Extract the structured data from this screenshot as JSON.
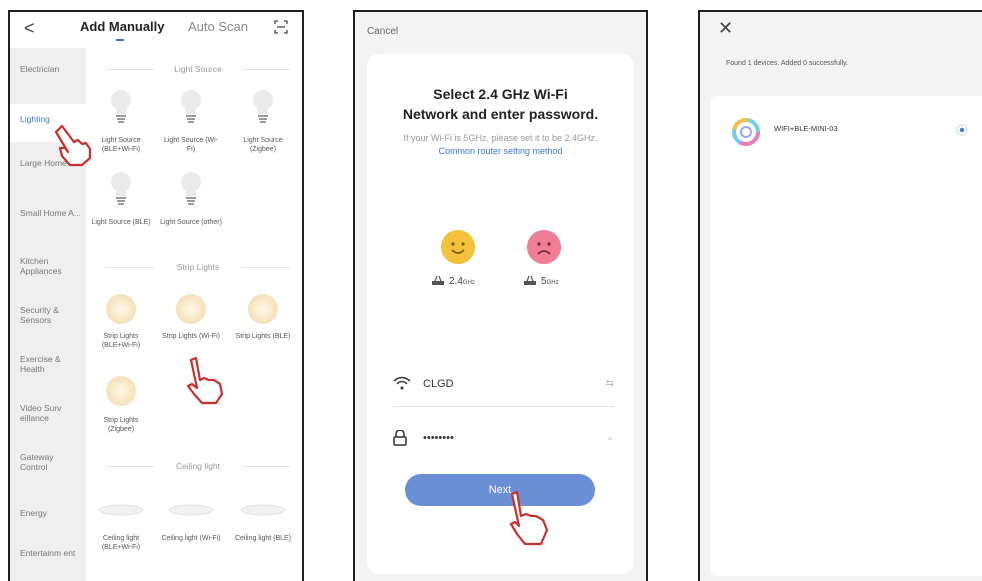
{
  "screen1": {
    "tabs": {
      "manual": "Add Manually",
      "auto": "Auto Scan"
    },
    "sidebar": [
      "Electrician",
      "Lighting",
      "Large Home A...",
      "Small Home A...",
      "Kitchen Appliances",
      "Security & Sensors",
      "Exercise & Health",
      "Video Surv eillance",
      "Gateway Control",
      "Energy",
      "Entertainm ent"
    ],
    "sections": {
      "light_source": "Light Source",
      "strip_lights": "Strip Lights",
      "ceiling_light": "Ceiling light"
    },
    "light_devices": [
      "Light Source (BLE+Wi-Fi)",
      "Light Source (Wi-Fi)",
      "Light Source (Zigbee)",
      "Light Source (BLE)",
      "Light Source (other)"
    ],
    "strip_devices": [
      "Strip Lights (BLE+Wi-Fi)",
      "Strip Lights (Wi-Fi)",
      "Strip Lights (BLE)",
      "Strip Lights (Zigbee)"
    ],
    "ceiling_devices": [
      "Ceiling light (BLE+Wi-Fi)",
      "Ceiling light (Wi-Fi)",
      "Ceiling light (BLE)"
    ]
  },
  "screen2": {
    "cancel": "Cancel",
    "title_line1": "Select 2.4 GHz Wi-Fi",
    "title_line2": "Network and enter password.",
    "sub_text": "If your Wi-Fi is 5GHz, please set it to be 2.4GHz.",
    "sub_link": "Common router setting method",
    "band_ok": "2.4",
    "band_bad": "5",
    "band_unit": "GHz",
    "wifi_name": "CLGD",
    "password": "••••••••",
    "next": "Next"
  },
  "screen3": {
    "found_text": "Found 1 devices. Added 0 successfully.",
    "device_name": "WIFI+BLE-MINI-03"
  },
  "colors": {
    "accent": "#3d7ad8",
    "button": "#6a8fd6",
    "hand": "#c9302c"
  }
}
